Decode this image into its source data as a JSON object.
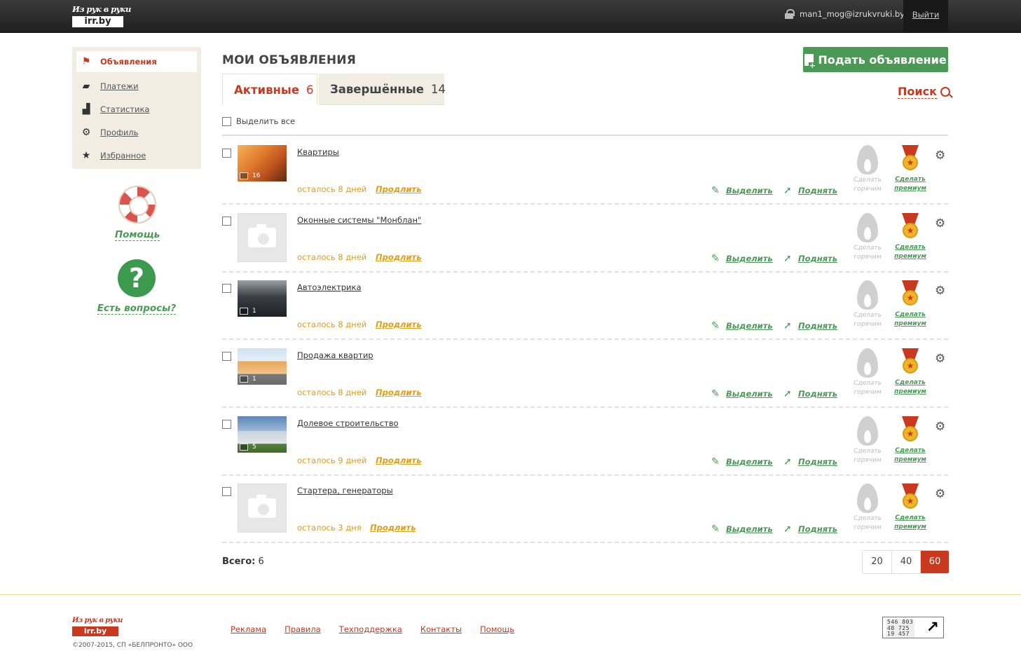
{
  "header": {
    "logo_script": "Из рук в руки",
    "logo_box": "irr.by",
    "user_email": "man1_mog@izrukvruki.by",
    "logout_label": "Выйти"
  },
  "sidebar": {
    "items": [
      {
        "label": "Объявления",
        "icon": "flag-icon"
      },
      {
        "label": "Платежи",
        "icon": "wallet-icon"
      },
      {
        "label": "Статистика",
        "icon": "bar-chart-icon"
      },
      {
        "label": "Профиль",
        "icon": "gears-icon"
      },
      {
        "label": "Избранное",
        "icon": "star-icon"
      }
    ],
    "help_label": "Помощь",
    "questions_label": "Есть вопросы?"
  },
  "main": {
    "title": "МОИ ОБЪЯВЛЕНИЯ",
    "add_button": "Подать объявление",
    "tabs": [
      {
        "label": "Активные",
        "count": "6"
      },
      {
        "label": "Завершённые",
        "count": "14"
      }
    ],
    "search_label": "Поиск",
    "select_all": "Выделить все",
    "extend_label": "Продлить",
    "highlight_label": "Выделить",
    "raise_label": "Поднять",
    "hot_label_1": "Сделать",
    "hot_label_2": "горячим",
    "premium_label_1": "Сделать",
    "premium_label_2": "премиум",
    "ads": [
      {
        "title": "Квартиры",
        "remaining": "осталось 8 дней",
        "photos": "16",
        "thumb": "room"
      },
      {
        "title": "Оконные системы \"Монблан\"",
        "remaining": "осталось 8 дней",
        "photos": "",
        "thumb": "none"
      },
      {
        "title": "Автоэлектрика",
        "remaining": "осталось 8 дней",
        "photos": "1",
        "thumb": "car"
      },
      {
        "title": "Продажа квартир",
        "remaining": "осталось 8 дней",
        "photos": "1",
        "thumb": "building"
      },
      {
        "title": "Долевое строительство",
        "remaining": "осталось 9 дней",
        "photos": "5",
        "thumb": "tower"
      },
      {
        "title": "Стартера, генераторы",
        "remaining": "осталось 3 дня",
        "photos": "",
        "thumb": "none"
      }
    ],
    "total_label": "Всего:",
    "total_value": "6",
    "page_sizes": [
      "20",
      "40",
      "60"
    ],
    "page_size_selected": "60"
  },
  "footer": {
    "logo_script": "Из рук в руки",
    "logo_box": "irr.by",
    "copyright": "©2007-2015, СП «БЕЛПРОНТО» ООО",
    "links": [
      "Реклама",
      "Правила",
      "Техподдержка",
      "Контакты",
      "Помощь"
    ],
    "counter_lines": [
      "546 803",
      "48 725",
      "19 457"
    ]
  },
  "colors": {
    "accent_red": "#c8391f",
    "accent_green": "#4a9a55",
    "accent_orange": "#e59b12"
  }
}
